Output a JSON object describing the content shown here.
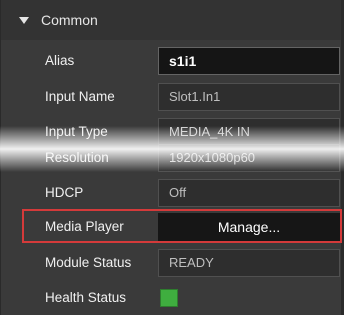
{
  "section": {
    "title": "Common",
    "collapse_icon": "caret-down-icon"
  },
  "rows": {
    "alias": {
      "label": "Alias",
      "value": "s1i1"
    },
    "input_name": {
      "label": "Input Name",
      "value": "Slot1.In1"
    },
    "input_type": {
      "label": "Input Type",
      "value": "MEDIA_4K IN"
    },
    "resolution": {
      "label": "Resolution",
      "value": "1920x1080p60"
    },
    "hdcp": {
      "label": "HDCP",
      "value": "Off"
    },
    "media_player": {
      "label": "Media Player",
      "button": "Manage..."
    },
    "module_status": {
      "label": "Module Status",
      "value": "READY"
    },
    "health_status": {
      "label": "Health Status",
      "indicator_color": "#3fae3f"
    }
  },
  "colors": {
    "highlight": "#d43a3a",
    "background": "#3a3a3a"
  }
}
